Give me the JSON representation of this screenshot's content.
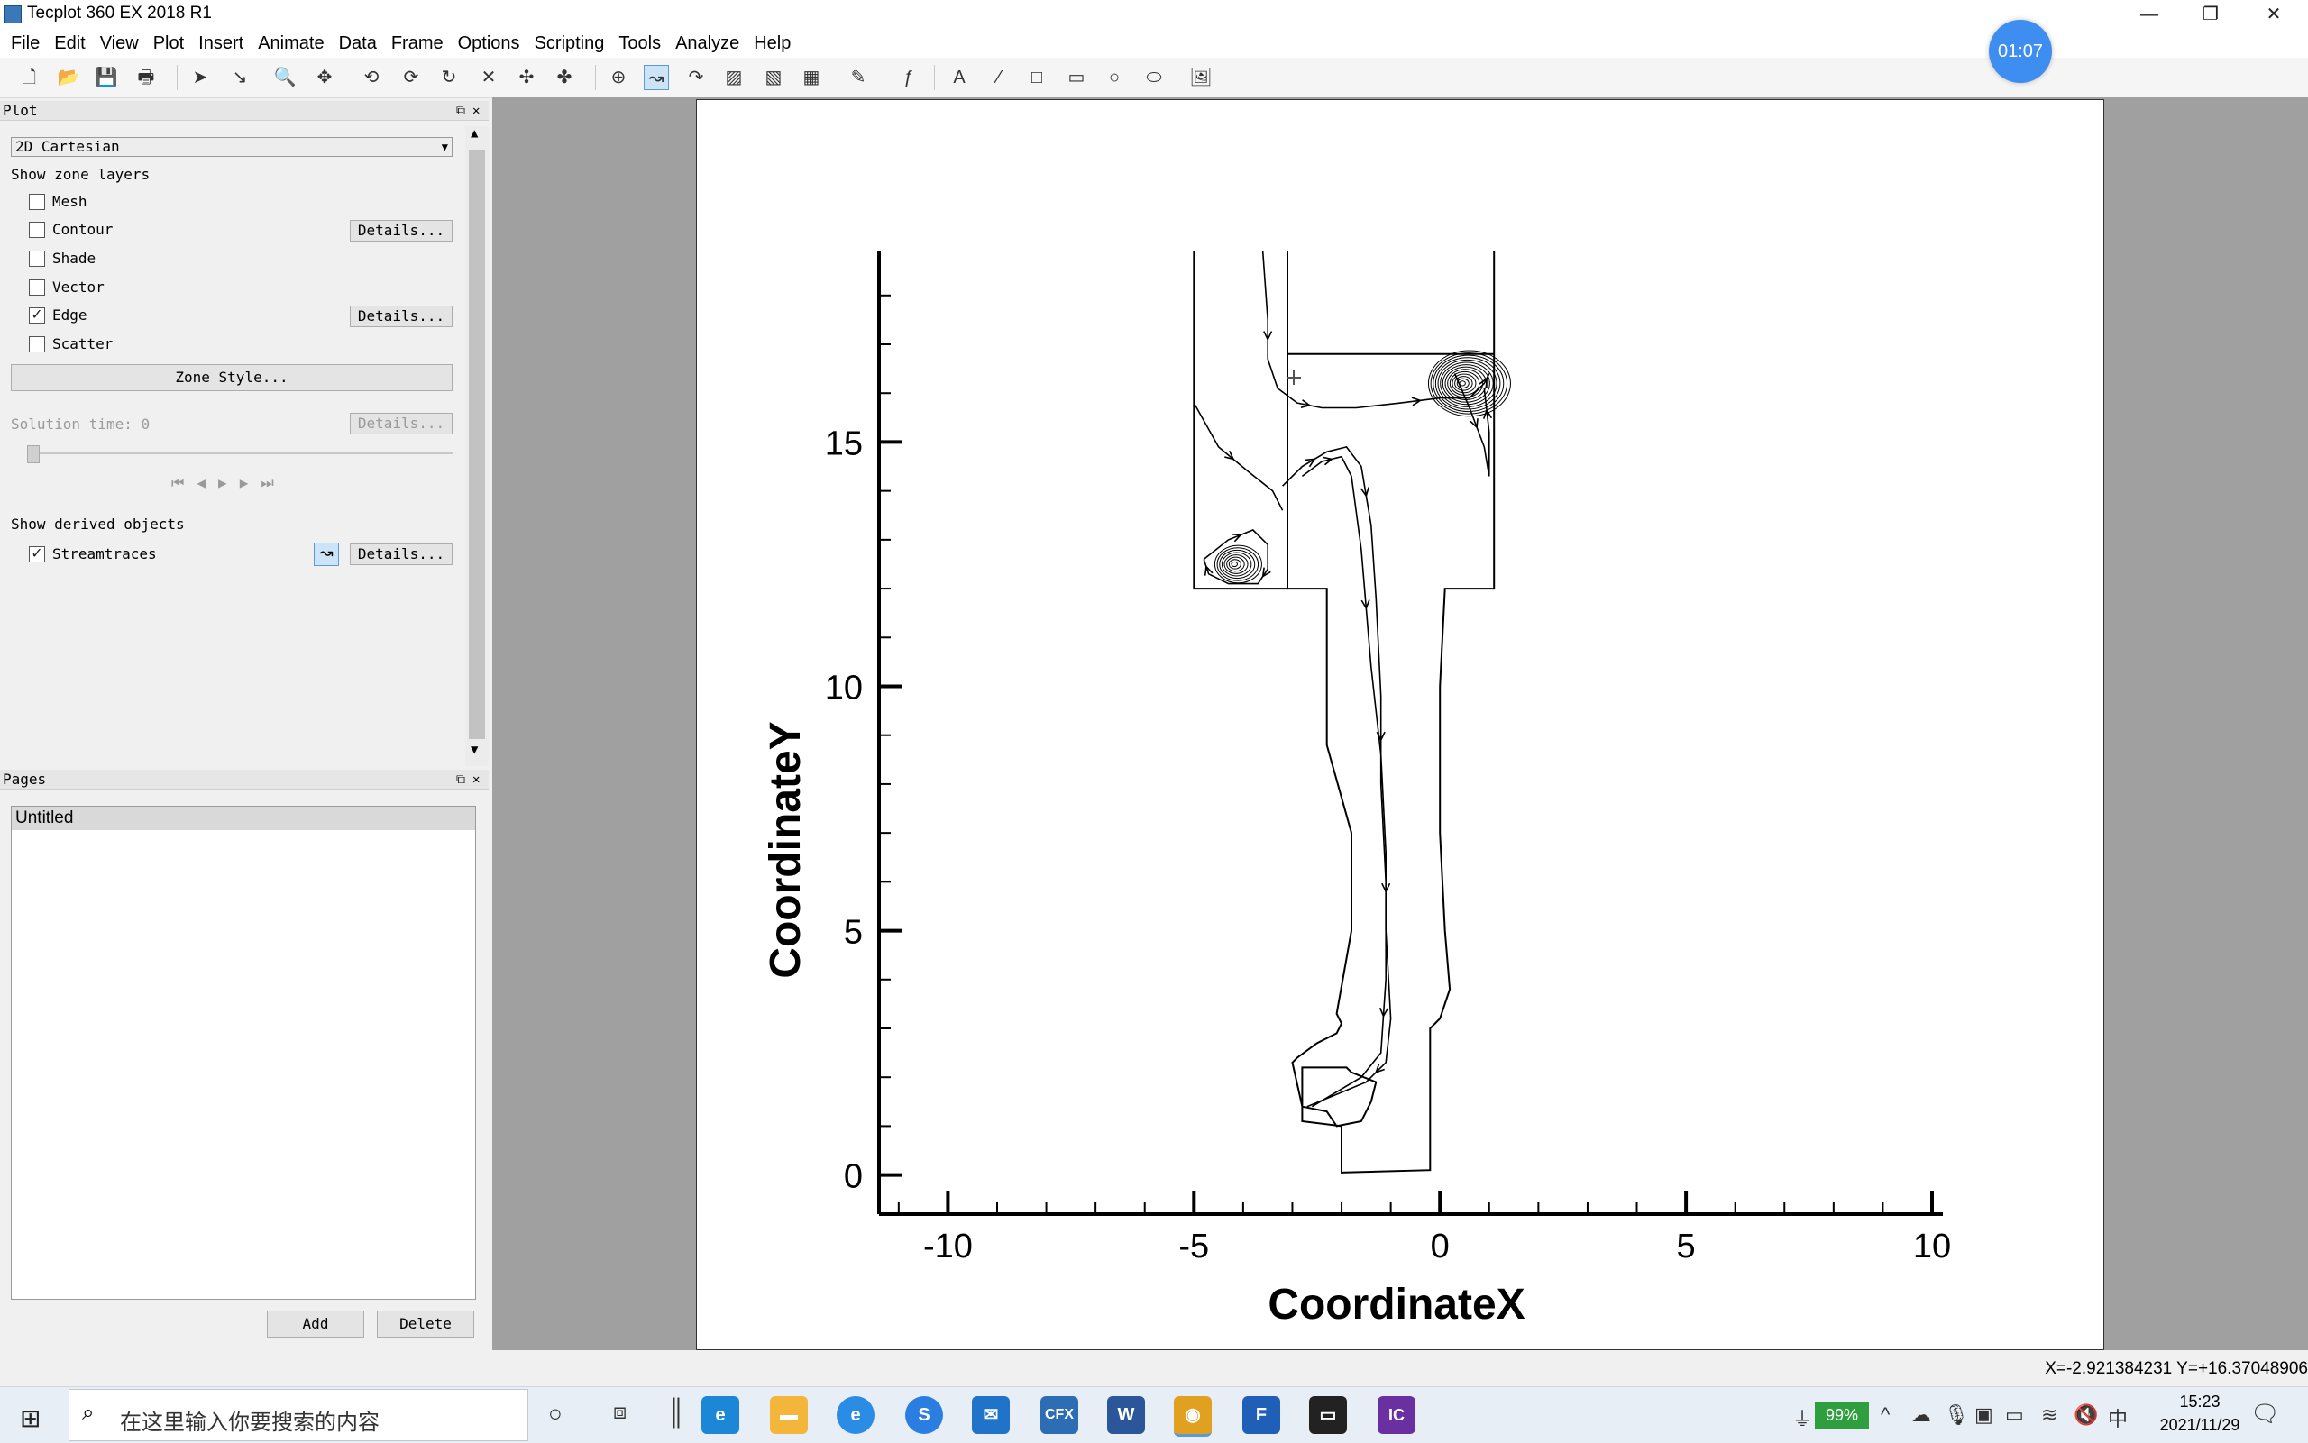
{
  "window": {
    "title": "Tecplot 360 EX 2018 R1",
    "minimize": "—",
    "restore": "❐",
    "close": "✕"
  },
  "timer": "01:07",
  "menu": [
    "File",
    "Edit",
    "View",
    "Plot",
    "Insert",
    "Animate",
    "Data",
    "Frame",
    "Options",
    "Scripting",
    "Tools",
    "Analyze",
    "Help"
  ],
  "plot_panel": {
    "header": "Plot",
    "plot_type": "2D Cartesian",
    "show_zone_layers": "Show zone layers",
    "layers": [
      {
        "label": "Mesh",
        "checked": false,
        "details": false
      },
      {
        "label": "Contour",
        "checked": false,
        "details": true
      },
      {
        "label": "Shade",
        "checked": false,
        "details": false
      },
      {
        "label": "Vector",
        "checked": false,
        "details": false
      },
      {
        "label": "Edge",
        "checked": true,
        "details": true
      },
      {
        "label": "Scatter",
        "checked": false,
        "details": false
      }
    ],
    "details_label": "Details...",
    "zone_style": "Zone Style...",
    "solution_time_label": "Solution time:",
    "solution_time_value": "0",
    "show_derived": "Show derived objects",
    "streamtraces": "Streamtraces",
    "streamtraces_checked": true
  },
  "pages_panel": {
    "header": "Pages",
    "items": [
      "Untitled"
    ],
    "add": "Add",
    "delete": "Delete"
  },
  "chart_data": {
    "type": "line",
    "xlabel": "CoordinateX",
    "ylabel": "CoordinateY",
    "xlim": [
      -11.4,
      10
    ],
    "ylim": [
      -0.8,
      18.9
    ],
    "xticks": [
      -10,
      -5,
      0,
      5,
      10
    ],
    "yticks": [
      0,
      5,
      10,
      15
    ],
    "geometry": [
      {
        "name": "boundary",
        "x": [
          -5,
          -5,
          -3.1,
          -3.1,
          -2.3,
          -2.3,
          -1.8,
          -1.8,
          -2.1,
          -2.0,
          -2.1,
          -2.5,
          -2.9,
          -3.0,
          -2.8,
          -2.3,
          -2.1,
          -1.6,
          -1.4,
          -1.3,
          -1.8,
          -1.9,
          -2.8,
          -2.8,
          -2.0,
          -2.0,
          -0.2,
          -0.2,
          -0.2,
          0.0,
          0.2,
          0.1,
          0.0,
          0.0,
          0.1,
          1.1,
          1.1,
          1.1
        ],
        "y": [
          18.9,
          12.0,
          12.0,
          12.0,
          12.0,
          8.8,
          7.0,
          5.0,
          3.3,
          3.1,
          2.9,
          2.7,
          2.4,
          2.3,
          1.4,
          1.3,
          1.0,
          1.1,
          1.5,
          1.9,
          2.1,
          2.2,
          2.2,
          1.1,
          1.0,
          0.05,
          0.1,
          1.2,
          3.0,
          3.2,
          3.8,
          5.0,
          7.0,
          10.0,
          12.0,
          12.0,
          15.0,
          18.9
        ]
      },
      {
        "name": "inner-wall-left",
        "x": [
          -3.1,
          -3.1
        ],
        "y": [
          18.9,
          12.0
        ]
      },
      {
        "name": "inner-box-top",
        "x": [
          -3.1,
          1.1
        ],
        "y": [
          16.8,
          16.8
        ]
      }
    ],
    "streamlines": [
      {
        "name": "main-stream",
        "x": [
          -3.6,
          -3.5,
          -3.5,
          -3.3,
          -2.9,
          -2.4,
          -1.7,
          -0.8,
          0.0,
          0.6,
          0.9,
          1.0
        ],
        "y": [
          18.9,
          17.5,
          16.7,
          16.1,
          15.8,
          15.7,
          15.7,
          15.8,
          15.9,
          15.9,
          16.2,
          16.4
        ]
      },
      {
        "name": "descending-1",
        "x": [
          -3.2,
          -2.8,
          -2.3,
          -1.9,
          -1.6,
          -1.4,
          -1.3,
          -1.2,
          -1.2,
          -1.1,
          -1.1,
          -1.2,
          -1.6,
          -2.6
        ],
        "y": [
          14.1,
          14.5,
          14.8,
          14.9,
          14.5,
          13.3,
          11.8,
          9.8,
          8.0,
          6.0,
          4.0,
          2.5,
          2.0,
          1.4
        ]
      },
      {
        "name": "descending-2",
        "x": [
          -2.8,
          -2.4,
          -2.0,
          -1.8,
          -1.6,
          -1.4,
          -1.2,
          -1.1,
          -1.1,
          -1.0,
          -1.1,
          -1.5,
          -2.7
        ],
        "y": [
          14.3,
          14.6,
          14.7,
          14.3,
          12.8,
          10.4,
          8.6,
          6.6,
          5.0,
          3.2,
          2.3,
          1.9,
          1.4
        ]
      },
      {
        "name": "inlet-left",
        "x": [
          -5.0,
          -4.5,
          -3.9,
          -3.4,
          -3.2
        ],
        "y": [
          15.8,
          14.9,
          14.4,
          14.0,
          13.6
        ]
      },
      {
        "name": "left-recirc",
        "x": [
          -4.8,
          -4.3,
          -3.8,
          -3.5,
          -3.5,
          -3.7,
          -4.3,
          -4.7,
          -4.8
        ],
        "y": [
          12.6,
          13.0,
          13.2,
          12.9,
          12.4,
          12.1,
          12.1,
          12.3,
          12.6
        ]
      },
      {
        "name": "right-recirc-tail",
        "x": [
          0.3,
          0.6,
          0.9,
          1.0,
          1.0,
          0.9
        ],
        "y": [
          16.4,
          15.7,
          14.9,
          14.3,
          15.2,
          16.1
        ]
      }
    ],
    "vortices": [
      {
        "name": "right-vortex",
        "x": 0.6,
        "y": 16.2,
        "rings": 14
      },
      {
        "name": "left-vortex",
        "x": -4.1,
        "y": 12.5,
        "rings": 8
      }
    ]
  },
  "status": {
    "coords": "X=-2.921384231  Y=+16.37048906"
  },
  "taskbar": {
    "search_placeholder": "在这里输入你要搜索的内容",
    "battery": "99%",
    "ime": "中",
    "time": "15:23",
    "date": "2021/11/29",
    "apps": [
      "CFX",
      "F",
      "IC"
    ]
  },
  "colors": {
    "accent": "#3d8ef0",
    "workspace": "#a0a0a0",
    "frame": "#ffffff"
  }
}
